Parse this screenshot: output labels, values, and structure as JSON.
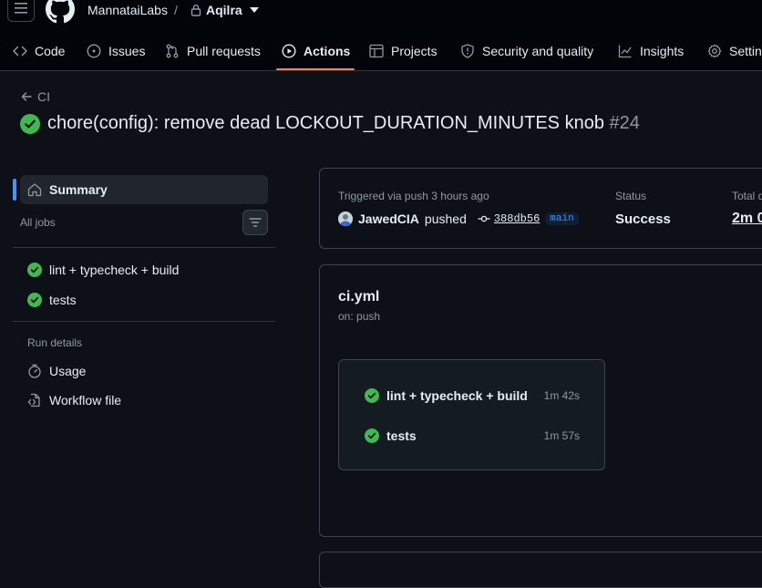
{
  "header": {
    "org": "MannataiLabs",
    "separator": "/",
    "repo": "Aqilra"
  },
  "tabs": [
    {
      "label": "Code",
      "icon": "code-icon"
    },
    {
      "label": "Issues",
      "icon": "issue-opened-icon"
    },
    {
      "label": "Pull requests",
      "icon": "git-pull-request-icon"
    },
    {
      "label": "Actions",
      "icon": "play-icon",
      "active": true
    },
    {
      "label": "Projects",
      "icon": "table-icon"
    },
    {
      "label": "Security and quality",
      "icon": "shield-icon"
    },
    {
      "label": "Insights",
      "icon": "graph-icon"
    },
    {
      "label": "Settin",
      "icon": "gear-icon"
    }
  ],
  "run": {
    "back_label": "CI",
    "title": "chore(config): remove dead LOCKOUT_DURATION_MINUTES knob",
    "number": "#24",
    "status_color": "#3fb950"
  },
  "sidebar": {
    "summary_label": "Summary",
    "all_jobs_label": "All jobs",
    "jobs": [
      {
        "label": "lint + typecheck + build"
      },
      {
        "label": "tests"
      }
    ],
    "run_details_label": "Run details",
    "details": [
      {
        "label": "Usage",
        "icon": "stopwatch-icon"
      },
      {
        "label": "Workflow file",
        "icon": "file-code-icon"
      }
    ]
  },
  "summary": {
    "triggered_label": "Triggered via push 3 hours ago",
    "actor": "JawedCIA",
    "action": "pushed",
    "commit_sha": "388db56",
    "branch": "main",
    "status_label": "Status",
    "status_value": "Success",
    "duration_label": "Total d",
    "duration_value": "2m 0"
  },
  "workflow": {
    "file": "ci.yml",
    "trigger": "on: push",
    "jobs": [
      {
        "name": "lint + typecheck + build",
        "time": "1m 42s"
      },
      {
        "name": "tests",
        "time": "1m 57s"
      }
    ]
  },
  "colors": {
    "accent_blue": "#4493f8",
    "success_green": "#3fb950",
    "tab_underline": "#f78166"
  }
}
